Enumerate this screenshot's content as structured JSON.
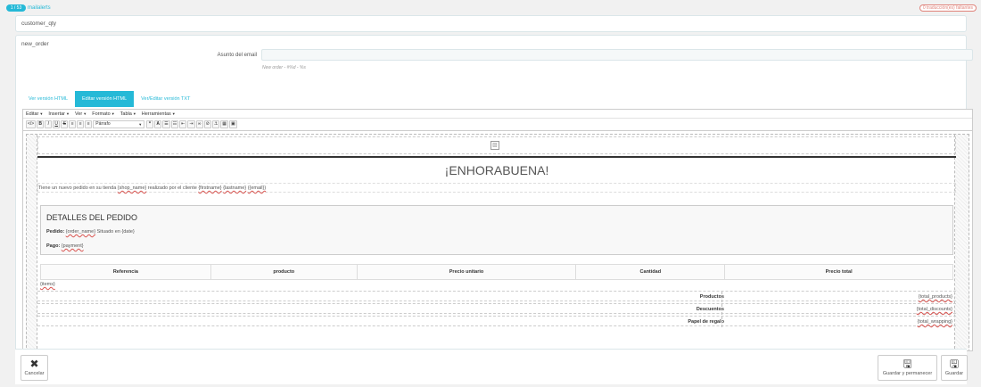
{
  "header": {
    "count_badge": "1 / 53",
    "module_name": "mailalerts",
    "missing_badge": "0 traducción(es) faltantes"
  },
  "customer_panel": {
    "title": "customer_qty"
  },
  "main": {
    "title": "new_order",
    "subject_label": "Asunto del email",
    "subject_value": "",
    "subject_help": "New order - #%d - %s",
    "tabs": [
      {
        "label": "Ver versión HTML",
        "active": false
      },
      {
        "label": "Editar versión HTML",
        "active": true
      },
      {
        "label": "Ver/Editar versión TXT",
        "active": false
      }
    ]
  },
  "editor": {
    "menus": [
      "Editar",
      "Insertar",
      "Ver",
      "Formato",
      "Tabla",
      "Herramientas"
    ],
    "format_select": "Párrafo",
    "toolbar_icons": [
      "code-icon",
      "bold-icon",
      "italic-icon",
      "underline-icon",
      "strikethrough-icon",
      "align-left-icon",
      "align-center-icon",
      "align-right-icon",
      "format-select",
      "blockquote-icon",
      "text-color-icon",
      "bullet-list-icon",
      "numbered-list-icon",
      "outdent-icon",
      "indent-icon",
      "link-icon",
      "unlink-icon",
      "anchor-icon",
      "table-icon",
      "image-icon"
    ]
  },
  "email": {
    "heading": "¡ENHORABUENA!",
    "intro_prefix": "Tiene un nuevo pedido en su tienda",
    "shop_var": "{shop_name}",
    "intro_mid": "realizado por el cliente",
    "firstname_var": "{firstname}",
    "lastname_var": "{lastname}",
    "email_var": "({email})",
    "details_title": "DETALLES DEL PEDIDO",
    "order_label": "Pedido:",
    "order_var": "{order_name}",
    "order_suffix": "Situado en {date}",
    "payment_label": "Pago:",
    "payment_var": "{payment}",
    "table_headers": [
      "Referencia",
      "producto",
      "Precio unitario",
      "Cantidad",
      "Precio total"
    ],
    "items_var": "{items}",
    "totals": [
      {
        "label": "Productos",
        "value": "{total_products}"
      },
      {
        "label": "Descuentos",
        "value": "{total_discounts}"
      },
      {
        "label": "Papel de regalo",
        "value": "{total_wrapping}"
      }
    ]
  },
  "footer": {
    "cancel": "Cancelar",
    "save_stay": "Guardar y permanecer",
    "save": "Guardar"
  }
}
